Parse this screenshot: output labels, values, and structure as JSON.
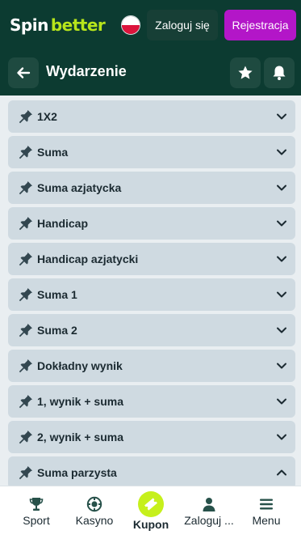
{
  "header": {
    "logo_spin": "Spin",
    "logo_better": "better",
    "login_label": "Zaloguj się",
    "register_label": "Rejestracja"
  },
  "subheader": {
    "title": "Wydarzenie"
  },
  "markets": [
    {
      "label": "1X2",
      "expanded": false
    },
    {
      "label": "Suma",
      "expanded": false
    },
    {
      "label": "Suma azjatycka",
      "expanded": false
    },
    {
      "label": "Handicap",
      "expanded": false
    },
    {
      "label": "Handicap azjatycki",
      "expanded": false
    },
    {
      "label": "Suma 1",
      "expanded": false
    },
    {
      "label": "Suma 2",
      "expanded": false
    },
    {
      "label": "Dokładny wynik",
      "expanded": false
    },
    {
      "label": "1, wynik + suma",
      "expanded": false
    },
    {
      "label": "2, wynik + suma",
      "expanded": false
    },
    {
      "label": "Suma parzysta",
      "expanded": true
    }
  ],
  "bottom_nav": [
    {
      "label": "Sport",
      "icon": "trophy-icon"
    },
    {
      "label": "Kasyno",
      "icon": "chip-icon"
    },
    {
      "label": "Kupon",
      "icon": "ticket-icon"
    },
    {
      "label": "Zaloguj ...",
      "icon": "user-icon"
    },
    {
      "label": "Menu",
      "icon": "menu-icon"
    }
  ],
  "colors": {
    "header_bg": "#0c3b31",
    "accent_green": "#b7e51b",
    "register_purple": "#b316c8",
    "market_bg": "#cfdae1",
    "kupon_lime": "#c6f01c"
  }
}
